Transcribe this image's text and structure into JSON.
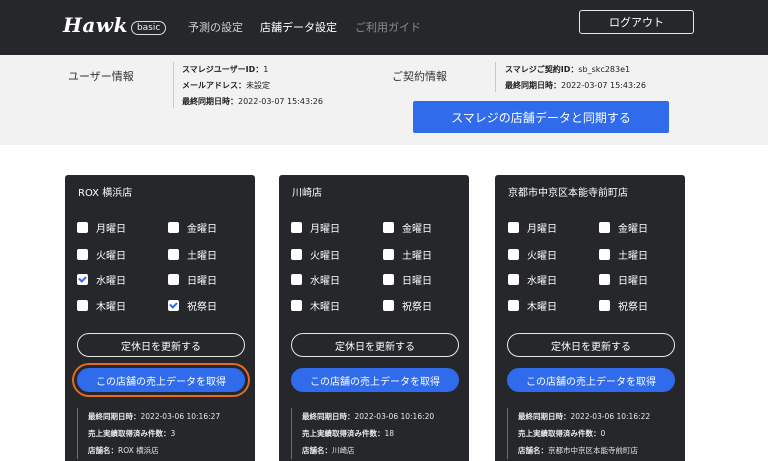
{
  "header": {
    "logo": "Hawk",
    "logo_badge": "basic",
    "nav": [
      "予測の設定",
      "店舗データ設定",
      "ご利用ガイド"
    ],
    "logout_label": "ログアウト"
  },
  "user_info": {
    "heading": "ユーザー情報",
    "id_label": "スマレジユーザーID：",
    "id_value": "1",
    "email_label": "メールアドレス：",
    "email_value": "未設定",
    "sync_label": "最終同期日時：",
    "sync_value": "2022-03-07 15:43:26"
  },
  "contract_info": {
    "heading": "ご契約情報",
    "id_label": "スマレジご契約ID：",
    "id_value": "sb_skc283e1",
    "sync_label": "最終同期日時：",
    "sync_value": "2022-03-07 15:43:26"
  },
  "sync_button": "スマレジの店舗データと同期する",
  "colors": {
    "accent": "#2f6bea",
    "dark": "#25272b",
    "focus_ring": "#e26b1f"
  },
  "stores": [
    {
      "name": "ROX 横浜店",
      "days": [
        {
          "label": "月曜日",
          "checked": false
        },
        {
          "label": "火曜日",
          "checked": false
        },
        {
          "label": "水曜日",
          "checked": true
        },
        {
          "label": "木曜日",
          "checked": false
        },
        {
          "label": "金曜日",
          "checked": false
        },
        {
          "label": "土曜日",
          "checked": false
        },
        {
          "label": "日曜日",
          "checked": false
        },
        {
          "label": "祝祭日",
          "checked": true
        }
      ],
      "update_label": "定休日を更新する",
      "fetch_label": "この店舗の売上データを取得",
      "info": [
        {
          "k": "最終同期日時：",
          "v": "2022-03-06 10:16:27"
        },
        {
          "k": "売上実績取得済み件数：",
          "v": "3"
        },
        {
          "k": "店舗名：",
          "v": "ROX 横浜店"
        }
      ]
    },
    {
      "name": "川崎店",
      "days": [
        {
          "label": "月曜日",
          "checked": false
        },
        {
          "label": "火曜日",
          "checked": false
        },
        {
          "label": "水曜日",
          "checked": false
        },
        {
          "label": "木曜日",
          "checked": false
        },
        {
          "label": "金曜日",
          "checked": false
        },
        {
          "label": "土曜日",
          "checked": false
        },
        {
          "label": "日曜日",
          "checked": false
        },
        {
          "label": "祝祭日",
          "checked": false
        }
      ],
      "update_label": "定休日を更新する",
      "fetch_label": "この店舗の売上データを取得",
      "info": [
        {
          "k": "最終同期日時：",
          "v": "2022-03-06 10:16:20"
        },
        {
          "k": "売上実績取得済み件数：",
          "v": "18"
        },
        {
          "k": "店舗名：",
          "v": "川崎店"
        }
      ]
    },
    {
      "name": "京都市中京区本能寺前町店",
      "days": [
        {
          "label": "月曜日",
          "checked": false
        },
        {
          "label": "火曜日",
          "checked": false
        },
        {
          "label": "水曜日",
          "checked": false
        },
        {
          "label": "木曜日",
          "checked": false
        },
        {
          "label": "金曜日",
          "checked": false
        },
        {
          "label": "土曜日",
          "checked": false
        },
        {
          "label": "日曜日",
          "checked": false
        },
        {
          "label": "祝祭日",
          "checked": false
        }
      ],
      "update_label": "定休日を更新する",
      "fetch_label": "この店舗の売上データを取得",
      "info": [
        {
          "k": "最終同期日時：",
          "v": "2022-03-06 10:16:22"
        },
        {
          "k": "売上実績取得済み件数：",
          "v": "0"
        },
        {
          "k": "店舗名：",
          "v": "京都市中京区本能寺前町店"
        }
      ]
    }
  ]
}
